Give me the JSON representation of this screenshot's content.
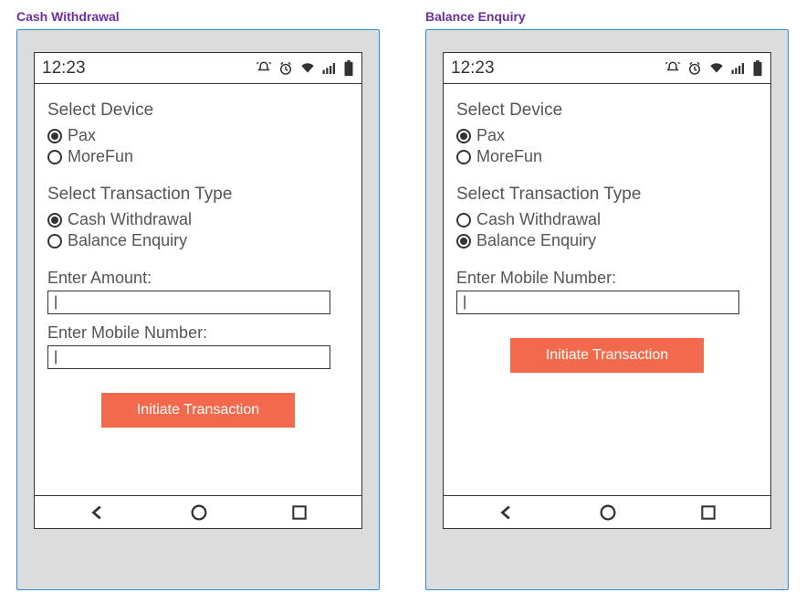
{
  "panels": [
    {
      "title": "Cash Withdrawal",
      "status_time": "12:23",
      "form": {
        "device_label": "Select Device",
        "device_options": [
          {
            "label": "Pax",
            "selected": true
          },
          {
            "label": "MoreFun",
            "selected": false
          }
        ],
        "txn_label": "Select Transaction Type",
        "txn_options": [
          {
            "label": "Cash Withdrawal",
            "selected": true
          },
          {
            "label": "Balance Enquiry",
            "selected": false
          }
        ],
        "fields": [
          {
            "label": "Enter Amount:",
            "value": ""
          },
          {
            "label": "Enter Mobile Number:",
            "value": ""
          }
        ],
        "button_label": "Initiate Transaction"
      }
    },
    {
      "title": "Balance Enquiry",
      "status_time": "12:23",
      "form": {
        "device_label": "Select Device",
        "device_options": [
          {
            "label": "Pax",
            "selected": true
          },
          {
            "label": "MoreFun",
            "selected": false
          }
        ],
        "txn_label": "Select Transaction Type",
        "txn_options": [
          {
            "label": "Cash Withdrawal",
            "selected": false
          },
          {
            "label": "Balance Enquiry",
            "selected": true
          }
        ],
        "fields": [
          {
            "label": "Enter Mobile Number:",
            "value": ""
          }
        ],
        "button_label": "Initiate Transaction"
      }
    }
  ],
  "colors": {
    "accent_button": "#f26a4b",
    "panel_title": "#6b2fa0",
    "panel_border": "#2a8fd4"
  }
}
